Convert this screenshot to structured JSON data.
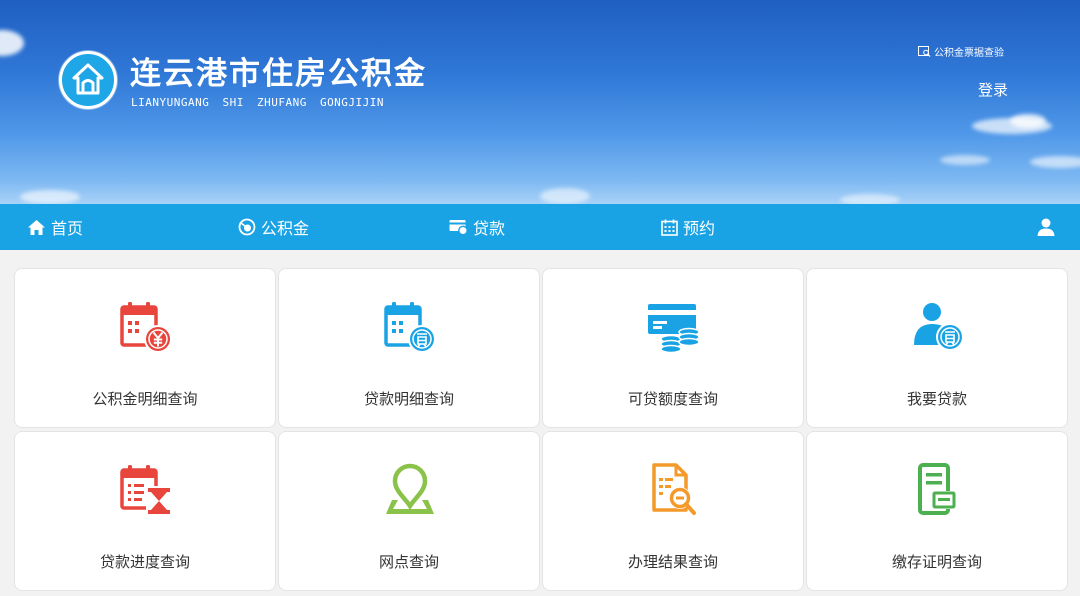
{
  "header": {
    "title": "连云港市住房公积金",
    "subtitle": "LIANYUNGANG SHI ZHUFANG GONGJIJIN",
    "verify_link": "公积金票据查验",
    "login": "登录",
    "logo_icon": "house-icon"
  },
  "nav": {
    "items": [
      {
        "label": "首页",
        "icon": "home-icon"
      },
      {
        "label": "公积金",
        "icon": "fund-icon"
      },
      {
        "label": "贷款",
        "icon": "loan-card-icon"
      },
      {
        "label": "预约",
        "icon": "calendar-icon"
      }
    ],
    "user_icon": "user-icon"
  },
  "tiles": [
    {
      "label": "公积金明细查询",
      "icon": "calendar-yuan-icon",
      "color": "#e8453c"
    },
    {
      "label": "贷款明细查询",
      "icon": "calendar-loan-icon",
      "color": "#1aa3e4"
    },
    {
      "label": "可贷额度查询",
      "icon": "card-coins-icon",
      "color": "#1aa3e4"
    },
    {
      "label": "我要贷款",
      "icon": "user-loan-icon",
      "color": "#1aa3e4"
    },
    {
      "label": "贷款进度查询",
      "icon": "calendar-hourglass-icon",
      "color": "#e8453c"
    },
    {
      "label": "网点查询",
      "icon": "map-pin-icon",
      "color": "#8bc34a"
    },
    {
      "label": "办理结果查询",
      "icon": "document-search-icon",
      "color": "#f39a2a"
    },
    {
      "label": "缴存证明查询",
      "icon": "certificate-icon",
      "color": "#4caf50"
    }
  ],
  "colors": {
    "nav_bg": "#1aa3e4",
    "page_bg": "#f2f2f2",
    "tile_bg": "#ffffff"
  }
}
